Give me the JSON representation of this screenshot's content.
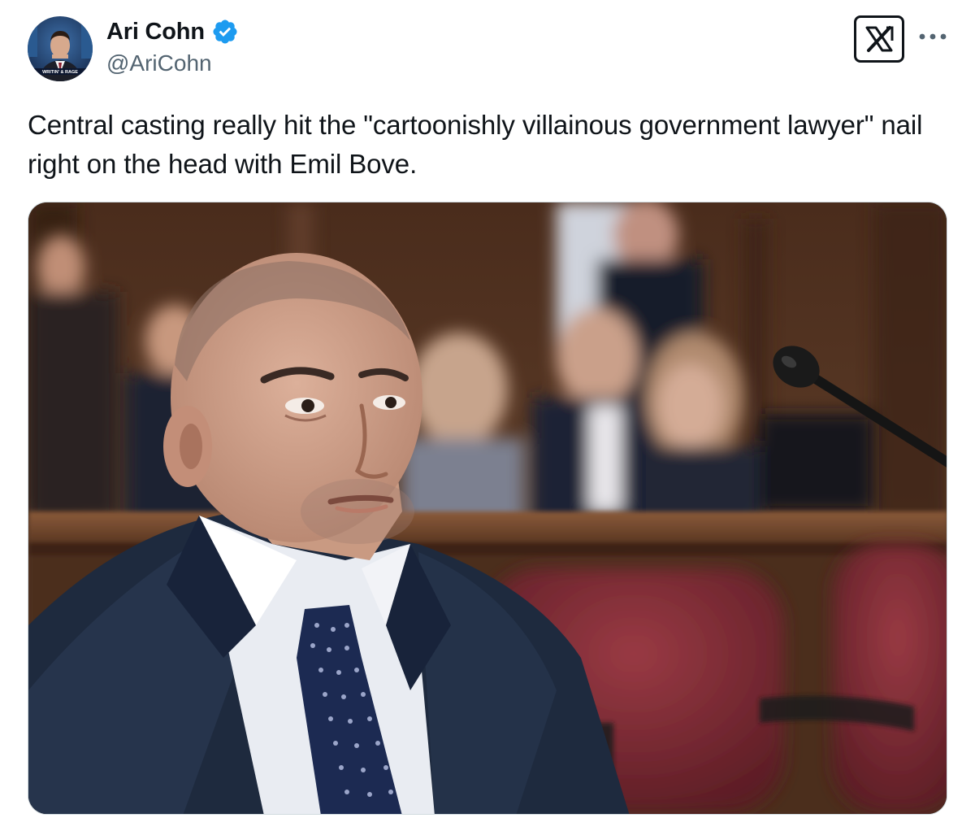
{
  "author": {
    "display_name": "Ari Cohn",
    "handle": "@AriCohn",
    "verified": true,
    "avatar_icon": "profile-photo",
    "verified_icon": "verified-badge-icon",
    "avatar_caption": "WRITIN' & RAGE"
  },
  "header": {
    "x_logo_icon": "x-logo-icon",
    "more_icon": "more-options-icon"
  },
  "tweet": {
    "text": "Central casting really hit the \"cartoonishly villainous government lawyer\" nail right on the head with Emil Bove."
  },
  "media": {
    "type": "photo",
    "subject": "courtroom-photo"
  },
  "colors": {
    "verified_blue": "#1d9bf0",
    "secondary_text": "#536471",
    "primary_text": "#0f1419",
    "border": "#cfd9de"
  }
}
